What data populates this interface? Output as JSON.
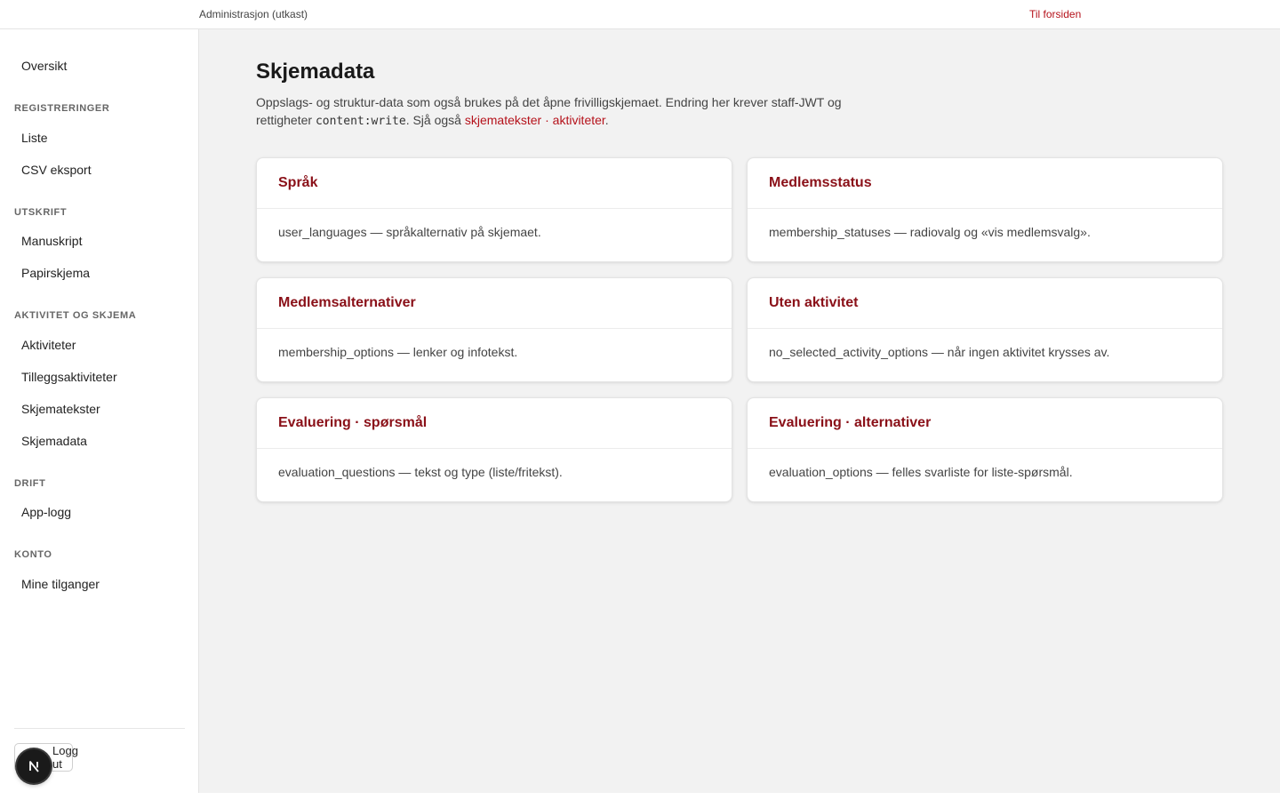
{
  "header": {
    "brand": "Administrasjon (utkast)",
    "home_link": "Til forsiden"
  },
  "sidebar": {
    "top_item": "Oversikt",
    "sections": [
      {
        "title": "REGISTRERINGER",
        "items": [
          "Liste",
          "CSV eksport"
        ]
      },
      {
        "title": "UTSKRIFT",
        "items": [
          "Manuskript",
          "Papirskjema"
        ]
      },
      {
        "title": "AKTIVITET OG SKJEMA",
        "items": [
          "Aktiviteter",
          "Tilleggsaktiviteter",
          "Skjematekster",
          "Skjemadata"
        ]
      },
      {
        "title": "DRIFT",
        "items": [
          "App-logg"
        ]
      },
      {
        "title": "KONTO",
        "items": [
          "Mine tilganger"
        ]
      }
    ],
    "logout_label": "Logg ut"
  },
  "main": {
    "title": "Skjemadata",
    "intro": {
      "text_1": "Oppslags- og struktur-data som også brukes på det åpne frivilligskjemaet. Endring her krever staff-JWT og rettigheter ",
      "code": "content:write",
      "text_2": ". Sjå også ",
      "link_1": "skjematekster",
      "separator": " · ",
      "link_2": "aktiviteter",
      "text_3": "."
    },
    "cards": [
      {
        "title": "Språk",
        "description": "user_languages — språkalternativ på skjemaet."
      },
      {
        "title": "Medlemsstatus",
        "description": "membership_statuses — radiovalg og «vis medlemsvalg»."
      },
      {
        "title": "Medlemsalternativer",
        "description": "membership_options — lenker og infotekst."
      },
      {
        "title": "Uten aktivitet",
        "description": "no_selected_activity_options — når ingen aktivitet krysses av."
      },
      {
        "title": "Evaluering · spørsmål",
        "description": "evaluation_questions — tekst og type (liste/fritekst)."
      },
      {
        "title": "Evaluering · alternativer",
        "description": "evaluation_options — felles svarliste for liste-spørsmål."
      }
    ]
  },
  "icons": {
    "dev_badge": "nextjs-icon"
  },
  "colors": {
    "accent": "#b5121b",
    "card_title": "#8a1018",
    "main_background": "#f2f2f2"
  }
}
